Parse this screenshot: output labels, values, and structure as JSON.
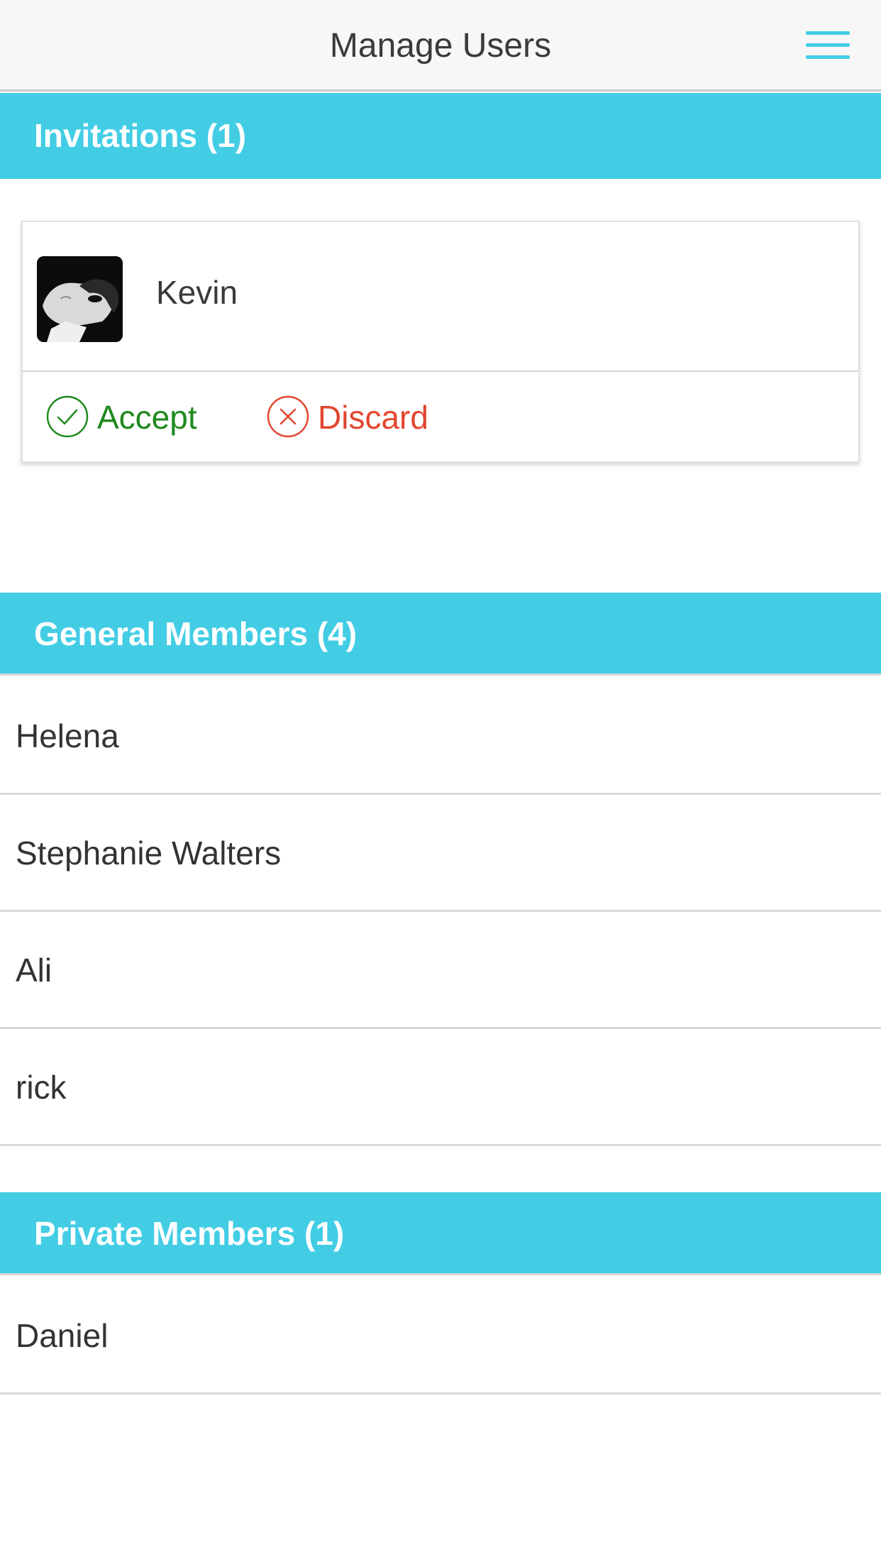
{
  "header": {
    "title": "Manage Users",
    "menu_icon": "hamburger-menu-icon",
    "accent_color": "#43cde5"
  },
  "invitations": {
    "title": "Invitations (1)",
    "items": [
      {
        "name": "Kevin",
        "avatar": "profile-photo",
        "accept_label": "Accept",
        "discard_label": "Discard",
        "accept_icon": "check-circle-icon",
        "discard_icon": "x-circle-icon",
        "accept_color": "#1e8a1e",
        "discard_color": "#e2462f"
      }
    ]
  },
  "general_members": {
    "title": "General Members (4)",
    "items": [
      "Helena",
      "Stephanie Walters",
      "Ali",
      "rick"
    ]
  },
  "private_members": {
    "title": "Private Members (1)",
    "items": [
      "Daniel"
    ]
  }
}
